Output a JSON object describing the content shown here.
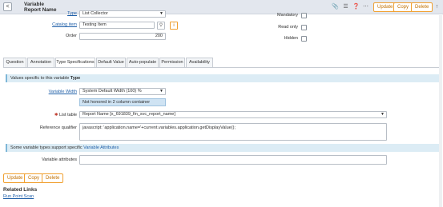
{
  "header": {
    "back_glyph": "<",
    "title_line1": "Variable",
    "title_line2": "Report Name",
    "icons": [
      "paperclip-icon",
      "settings-sliders-icon",
      "help-icon",
      "more-icon",
      "scroll-top-icon"
    ],
    "buttons": {
      "update": "Update",
      "copy": "Copy",
      "delete": "Delete"
    }
  },
  "upper_form": {
    "type_label": "Type",
    "type_value": "List Collector",
    "catalog_item_label": "Catalog item",
    "catalog_item_value": "Testing Item",
    "order_label": "Order",
    "order_value": "200",
    "mandatory_label": "Mandatory",
    "read_only_label": "Read only",
    "hidden_label": "Hidden"
  },
  "tabs": [
    "Question",
    "Annotation",
    "Type Specifications",
    "Default Value",
    "Auto-populate",
    "Permission",
    "Availability"
  ],
  "active_tab": "Type Specifications",
  "type_section": {
    "header_prefix": "Values specific to this variable ",
    "header_bold": "Type",
    "variable_width_label": "Variable Width",
    "variable_width_value": "System Default Width (100) %",
    "variable_width_note": "Not honored in 2 column container",
    "required_marker": "✱",
    "list_table_label": "List table",
    "list_table_value": "Report Name [x_691839_fin_svc_report_name]",
    "reference_qualifier_label": "Reference qualifier",
    "reference_qualifier_value": "javascript: 'application.name='+current.variables.application.getDisplayValue();"
  },
  "attributes_section": {
    "header_prefix": "Some variable types support specific ",
    "header_link": "Variable Attributes",
    "variable_attributes_label": "Variable attributes",
    "variable_attributes_value": ""
  },
  "footer_buttons": {
    "update": "Update",
    "copy": "Copy",
    "delete": "Delete"
  },
  "related_links": {
    "title": "Related Links",
    "items": [
      "Run Point Scan"
    ]
  },
  "colors": {
    "accent_button": "#f0a030",
    "link": "#1f5fa8",
    "section_bg": "#dcecf5"
  }
}
